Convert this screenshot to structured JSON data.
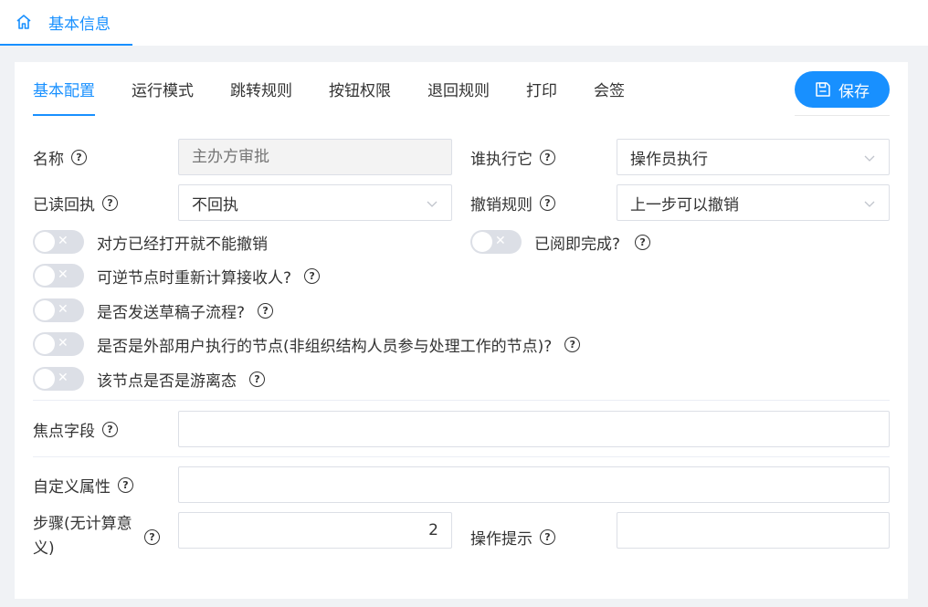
{
  "page_tab": {
    "label": "基本信息",
    "icon": "home-icon"
  },
  "tabs": [
    {
      "label": "基本配置",
      "active": true
    },
    {
      "label": "运行模式"
    },
    {
      "label": "跳转规则"
    },
    {
      "label": "按钮权限"
    },
    {
      "label": "退回规则"
    },
    {
      "label": "打印"
    },
    {
      "label": "会签"
    }
  ],
  "save_button": {
    "label": "保存",
    "icon": "save-icon"
  },
  "form": {
    "name": {
      "label": "名称",
      "placeholder": "主办方审批"
    },
    "executor": {
      "label": "谁执行它",
      "value": "操作员执行"
    },
    "read_receipt": {
      "label": "已读回执",
      "value": "不回执"
    },
    "revoke_rule": {
      "label": "撤销规则",
      "value": "上一步可以撤销"
    },
    "switches": {
      "no_revoke_after_open": "对方已经打开就不能撤销",
      "read_is_complete": "已阅即完成?",
      "recalc_receivers": "可逆节点时重新计算接收人?",
      "send_draft_subflow": "是否发送草稿子流程?",
      "external_user_node": "是否是外部用户执行的节点(非组织结构人员参与处理工作的节点)?",
      "free_node": "该节点是否是游离态"
    },
    "focus_field": {
      "label": "焦点字段",
      "value": ""
    },
    "custom_attr": {
      "label": "自定义属性",
      "value": ""
    },
    "step": {
      "label_line1": "步骤(无计算意",
      "label_line2": "义)",
      "value": "2"
    },
    "op_hint": {
      "label": "操作提示",
      "value": ""
    }
  },
  "colors": {
    "accent": "#1890ff",
    "switch_off": "#dcdfe6"
  }
}
